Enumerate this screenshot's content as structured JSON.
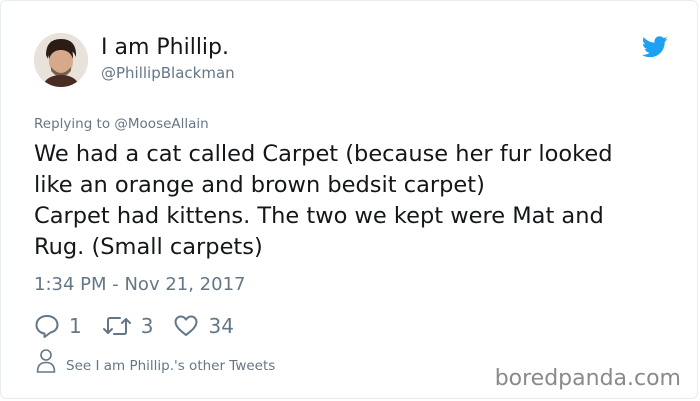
{
  "tweet": {
    "display_name": "I am Phillip.",
    "handle": "@PhillipBlackman",
    "replying_to": "Replying to @MooseAllain",
    "body_lines": [
      "We had a cat called Carpet (because her fur looked",
      "like an orange and brown bedsit carpet)",
      "Carpet had kittens. The two we kept were Mat and",
      "Rug. (Small carpets)"
    ],
    "timestamp": "1:34 PM - Nov 21, 2017",
    "actions": {
      "reply_count": "1",
      "retweet_count": "3",
      "like_count": "34"
    },
    "see_more": "See I am Phillip.'s other Tweets"
  },
  "watermark": "boredpanda.com",
  "icons": [
    "avatar",
    "twitter-bird-icon",
    "reply-icon",
    "retweet-icon",
    "heart-icon",
    "person-icon"
  ],
  "colors": {
    "text": "#14171a",
    "secondary": "#657786",
    "twitter_blue": "#1da1f2",
    "watermark": "#8a8a8a"
  }
}
